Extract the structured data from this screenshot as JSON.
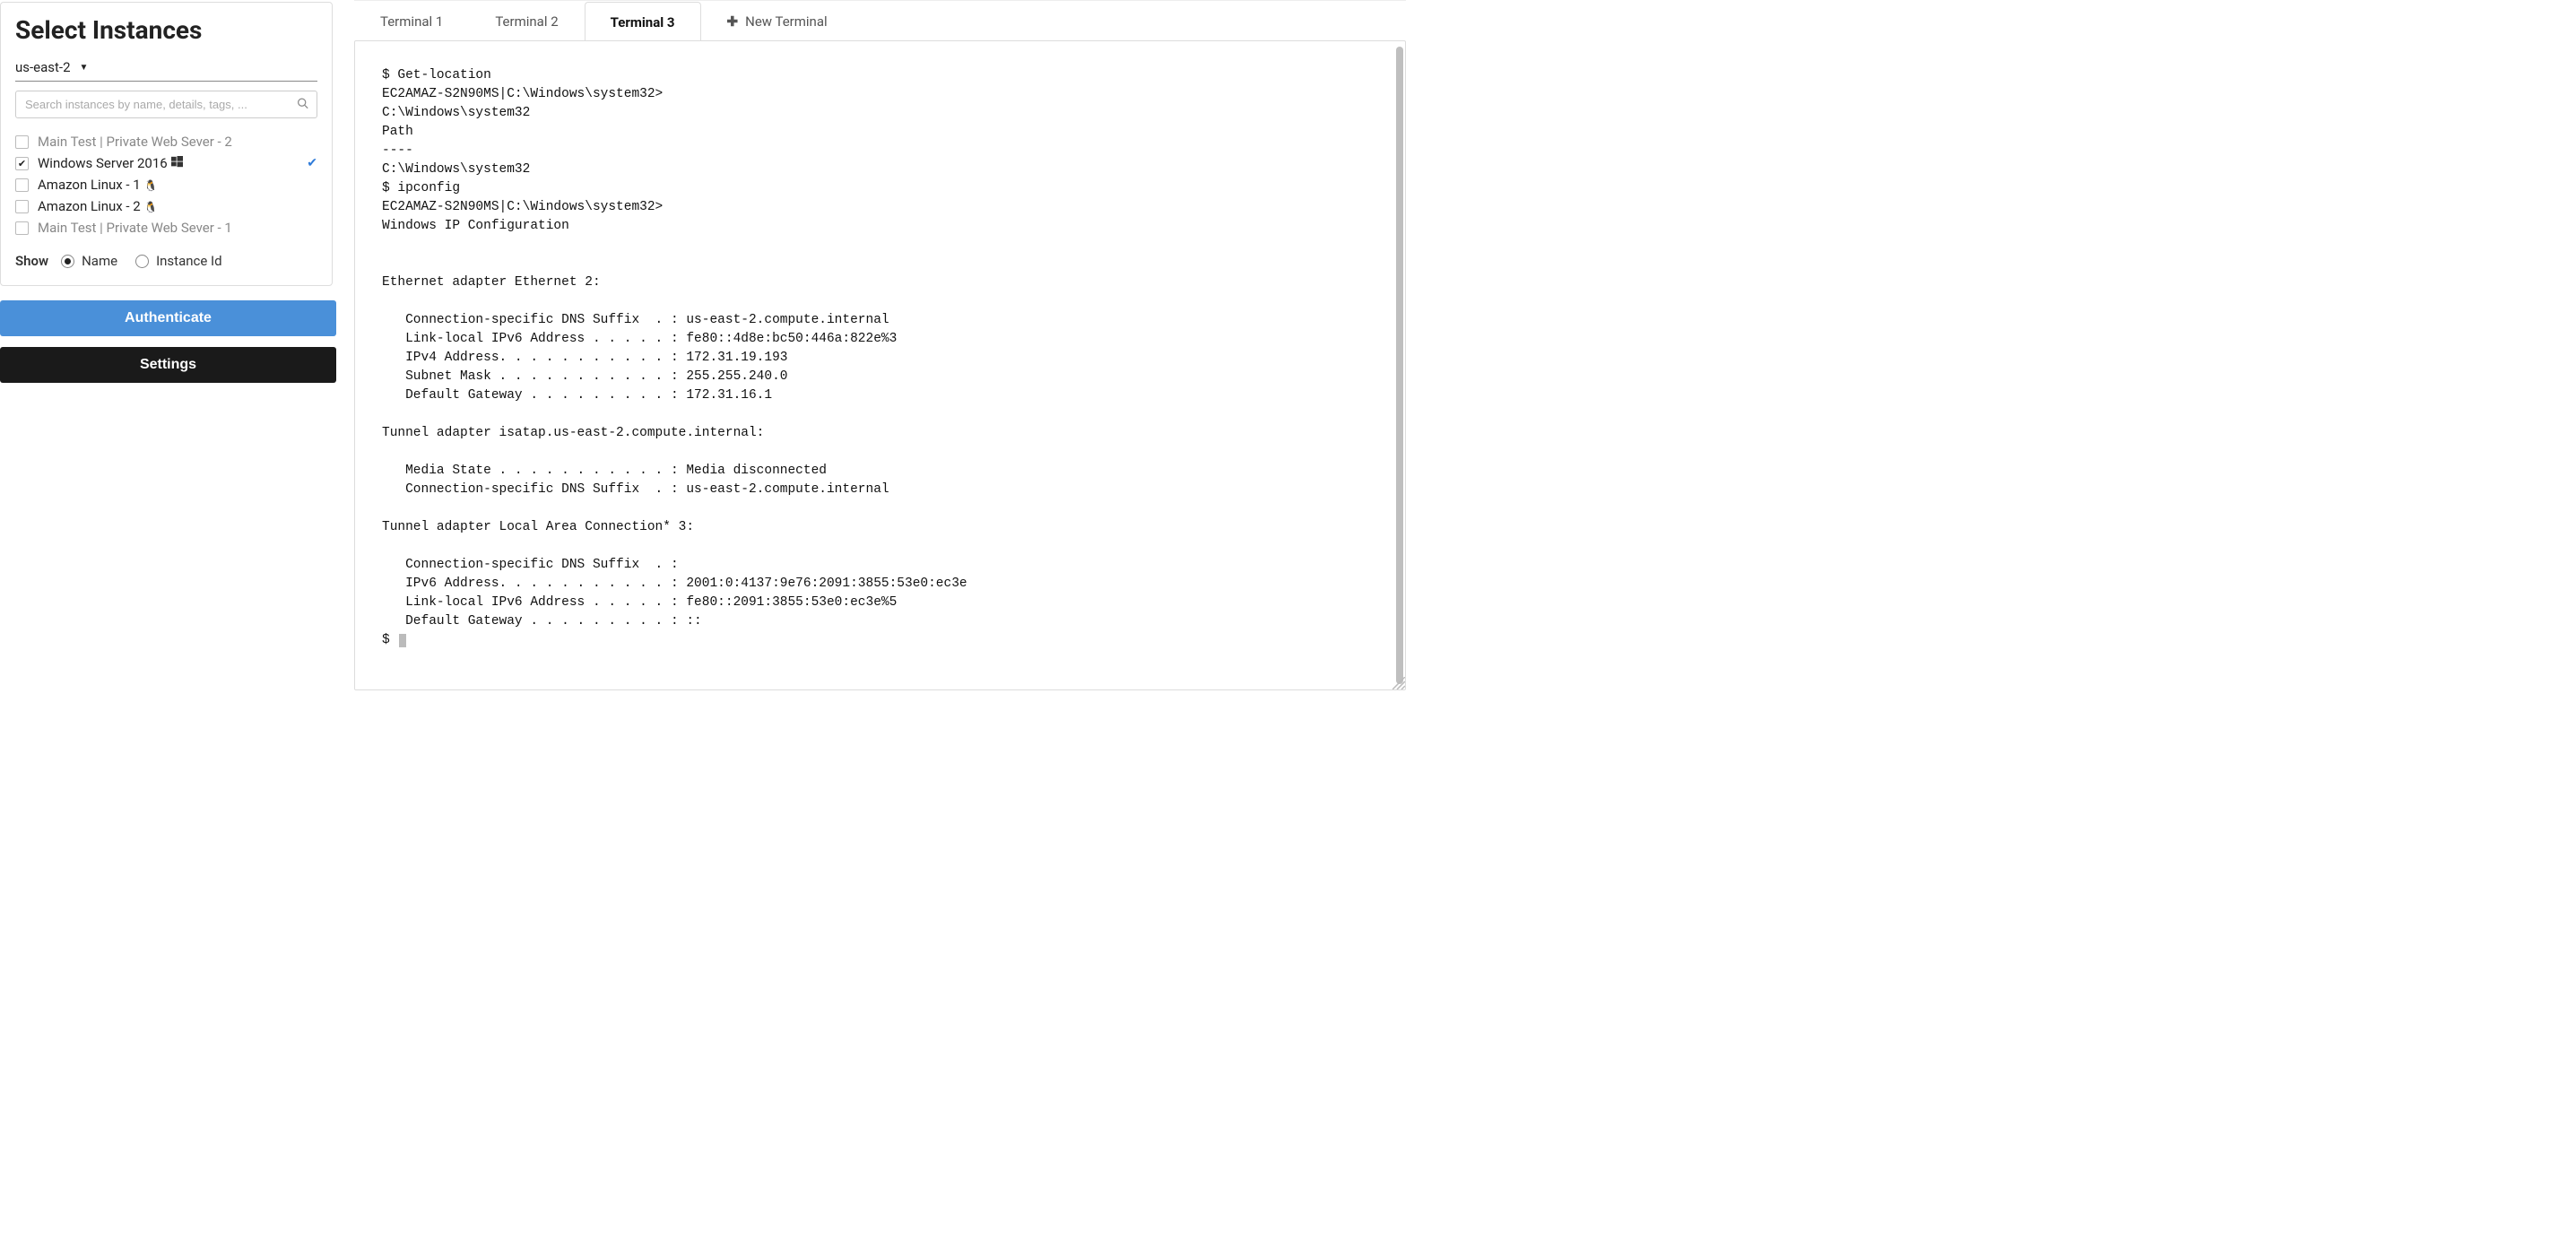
{
  "sidebar": {
    "title": "Select Instances",
    "region": "us-east-2",
    "search_placeholder": "Search instances by name, details, tags, ...",
    "instances": [
      {
        "label": "Main Test | Private Web Sever - 2",
        "checked": false,
        "disabled": true,
        "os": ""
      },
      {
        "label": "Windows Server 2016",
        "checked": true,
        "disabled": false,
        "os": "windows",
        "verified": true
      },
      {
        "label": "Amazon Linux - 1",
        "checked": false,
        "disabled": false,
        "os": "linux"
      },
      {
        "label": "Amazon Linux - 2",
        "checked": false,
        "disabled": false,
        "os": "linux"
      },
      {
        "label": "Main Test | Private Web Sever - 1",
        "checked": false,
        "disabled": true,
        "os": ""
      }
    ],
    "show_label": "Show",
    "show_options": [
      {
        "label": "Name",
        "selected": true
      },
      {
        "label": "Instance Id",
        "selected": false
      }
    ],
    "authenticate_label": "Authenticate",
    "settings_label": "Settings"
  },
  "tabs": [
    {
      "label": "Terminal 1",
      "active": false
    },
    {
      "label": "Terminal 2",
      "active": false
    },
    {
      "label": "Terminal 3",
      "active": true
    }
  ],
  "new_tab_label": "New Terminal",
  "terminal_lines": [
    "$ Get-location",
    "EC2AMAZ-S2N90MS|C:\\Windows\\system32>",
    "C:\\Windows\\system32",
    "Path",
    "----",
    "C:\\Windows\\system32",
    "$ ipconfig",
    "EC2AMAZ-S2N90MS|C:\\Windows\\system32>",
    "Windows IP Configuration",
    "",
    "",
    "Ethernet adapter Ethernet 2:",
    "",
    "   Connection-specific DNS Suffix  . : us-east-2.compute.internal",
    "   Link-local IPv6 Address . . . . . : fe80::4d8e:bc50:446a:822e%3",
    "   IPv4 Address. . . . . . . . . . . : 172.31.19.193",
    "   Subnet Mask . . . . . . . . . . . : 255.255.240.0",
    "   Default Gateway . . . . . . . . . : 172.31.16.1",
    "",
    "Tunnel adapter isatap.us-east-2.compute.internal:",
    "",
    "   Media State . . . . . . . . . . . : Media disconnected",
    "   Connection-specific DNS Suffix  . : us-east-2.compute.internal",
    "",
    "Tunnel adapter Local Area Connection* 3:",
    "",
    "   Connection-specific DNS Suffix  . :",
    "   IPv6 Address. . . . . . . . . . . : 2001:0:4137:9e76:2091:3855:53e0:ec3e",
    "   Link-local IPv6 Address . . . . . : fe80::2091:3855:53e0:ec3e%5",
    "   Default Gateway . . . . . . . . . : ::"
  ],
  "prompt": "$ ",
  "colors": {
    "primary": "#4a90d9",
    "dark": "#1a1a1a"
  }
}
